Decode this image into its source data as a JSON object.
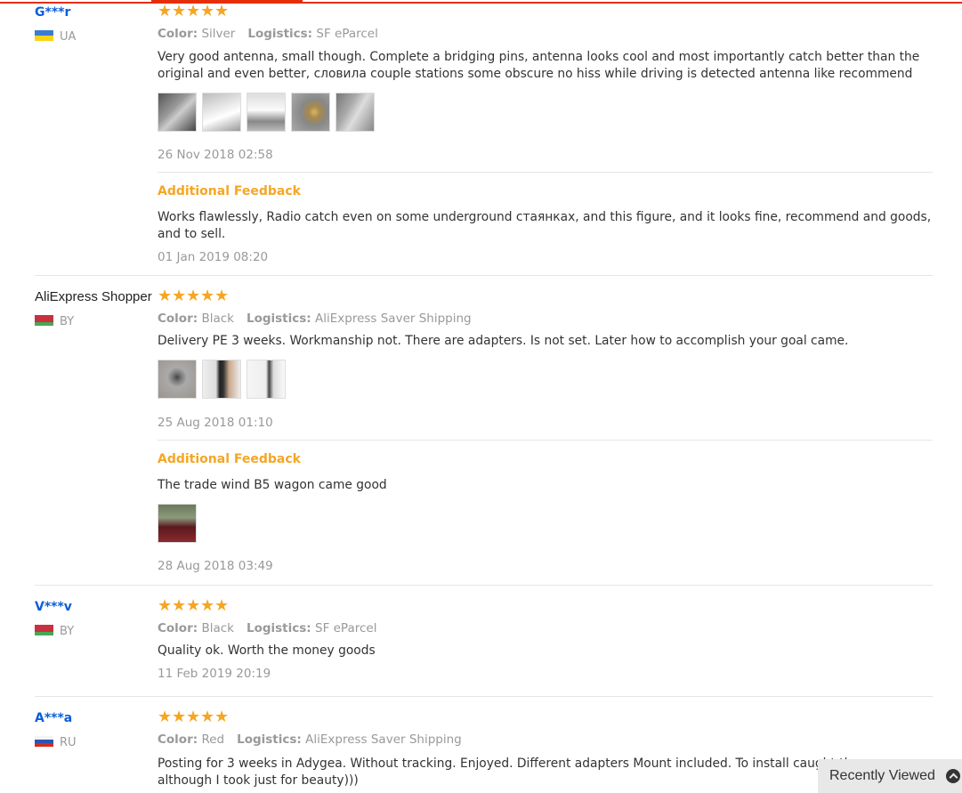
{
  "colors": {
    "accent": "#e62e04",
    "star": "#f5a623",
    "link": "#0b5ed7",
    "feedback": "#f5a623"
  },
  "reviews": [
    {
      "user": "G***r",
      "country": "UA",
      "stars": 5,
      "color_label": "Color:",
      "color": "Silver",
      "logistics_label": "Logistics:",
      "logistics": "SF eParcel",
      "text": "Very good antenna, small though. Complete a bridging pins, antenna looks cool and most importantly catch better than the original and even better, словила couple stations some obscure no hiss while driving is detected antenna like recommend",
      "date": "26 Nov 2018 02:58",
      "additional": {
        "heading": "Additional Feedback",
        "text": "Works flawlessly, Radio catch even on some underground стаянках, and this figure, and it looks fine, recommend and goods, and to sell.",
        "date": "01 Jan 2019 08:20"
      }
    },
    {
      "user": "AliExpress Shopper",
      "country": "BY",
      "stars": 5,
      "color_label": "Color:",
      "color": "Black",
      "logistics_label": "Logistics:",
      "logistics": "AliExpress Saver Shipping",
      "text": "Delivery PE 3 weeks. Workmanship not. There are adapters. Is not set. Later how to accomplish your goal came.",
      "date": "25 Aug 2018 01:10",
      "additional": {
        "heading": "Additional Feedback",
        "text": "The trade wind B5 wagon came good",
        "date": "28 Aug 2018 03:49"
      }
    },
    {
      "user": "V***v",
      "country": "BY",
      "stars": 5,
      "color_label": "Color:",
      "color": "Black",
      "logistics_label": "Logistics:",
      "logistics": "SF eParcel",
      "text": "Quality ok. Worth the money goods",
      "date": "11 Feb 2019 20:19"
    },
    {
      "user": "A***a",
      "country": "RU",
      "stars": 5,
      "color_label": "Color:",
      "color": "Red",
      "logistics_label": "Logistics:",
      "logistics": "AliExpress Saver Shipping",
      "text": "Posting for 3 weeks in Adygea. Without tracking. Enjoyed. Different adapters Mount included. To install caught th",
      "text2": "although I took just for beauty)))"
    }
  ],
  "recently_viewed": {
    "label": "Recently Viewed",
    "icon": "chevron-up-icon"
  }
}
